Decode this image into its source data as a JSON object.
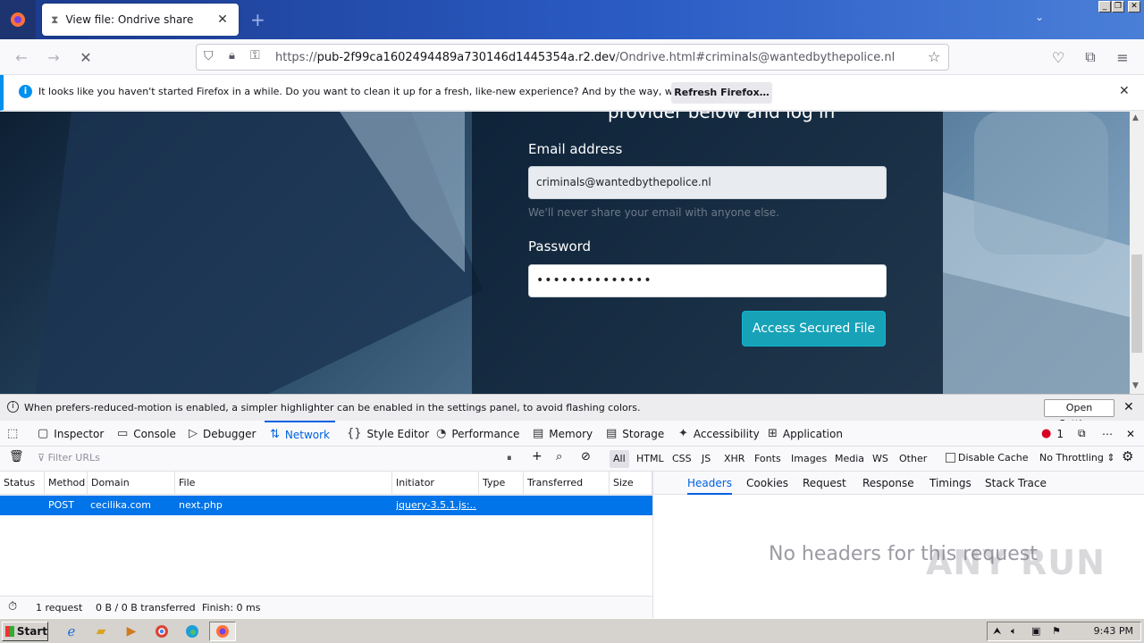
{
  "browser": {
    "tab_title": "View file: Ondrive share",
    "url_prefix": "https://",
    "url_host": "pub-2f99ca1602494489a730146d1445354a.r2.dev",
    "url_path": "/Ondrive.html#criminals@wantedbythepolice.nl"
  },
  "notification": {
    "text": "It looks like you haven't started Firefox in a while. Do you want to clean it up for a fresh, like-new experience? And by the way, welcome back!",
    "button": "Refresh Firefox…"
  },
  "page": {
    "heading": "provider below and log in",
    "email_label": "Email address",
    "email_value": "criminals@wantedbythepolice.nl",
    "email_hint": "We'll never share your email with anyone else.",
    "password_label": "Password",
    "password_value": "••••••••••••••",
    "submit": "Access Secured File"
  },
  "devtools": {
    "notice": "When prefers-reduced-motion is enabled, a simpler highlighter can be enabled in the settings panel, to avoid flashing colors.",
    "notice_button": "Open Settings",
    "tabs": [
      "Inspector",
      "Console",
      "Debugger",
      "Network",
      "Style Editor",
      "Performance",
      "Memory",
      "Storage",
      "Accessibility",
      "Application"
    ],
    "error_count": "1",
    "filter_placeholder": "Filter URLs",
    "filters": [
      "All",
      "HTML",
      "CSS",
      "JS",
      "XHR",
      "Fonts",
      "Images",
      "Media",
      "WS",
      "Other"
    ],
    "disable_cache": "Disable Cache",
    "throttling": "No Throttling ⇕",
    "columns": [
      "Status",
      "Method",
      "Domain",
      "File",
      "Initiator",
      "Type",
      "Transferred",
      "Size"
    ],
    "requests": [
      {
        "status": "",
        "method": "POST",
        "domain": "cecilika.com",
        "file": "next.php",
        "initiator": "jquery-3.5.1.js:...",
        "type": "",
        "transferred": "",
        "size": ""
      }
    ],
    "summary": {
      "requests": "1 request",
      "transferred": "0 B / 0 B transferred",
      "finish": "Finish: 0 ms"
    },
    "side_tabs": [
      "Headers",
      "Cookies",
      "Request",
      "Response",
      "Timings",
      "Stack Trace"
    ],
    "empty_text": "No headers for this request"
  },
  "watermark": "ANY RUN",
  "taskbar": {
    "start": "Start",
    "clock": "9:43 PM"
  }
}
